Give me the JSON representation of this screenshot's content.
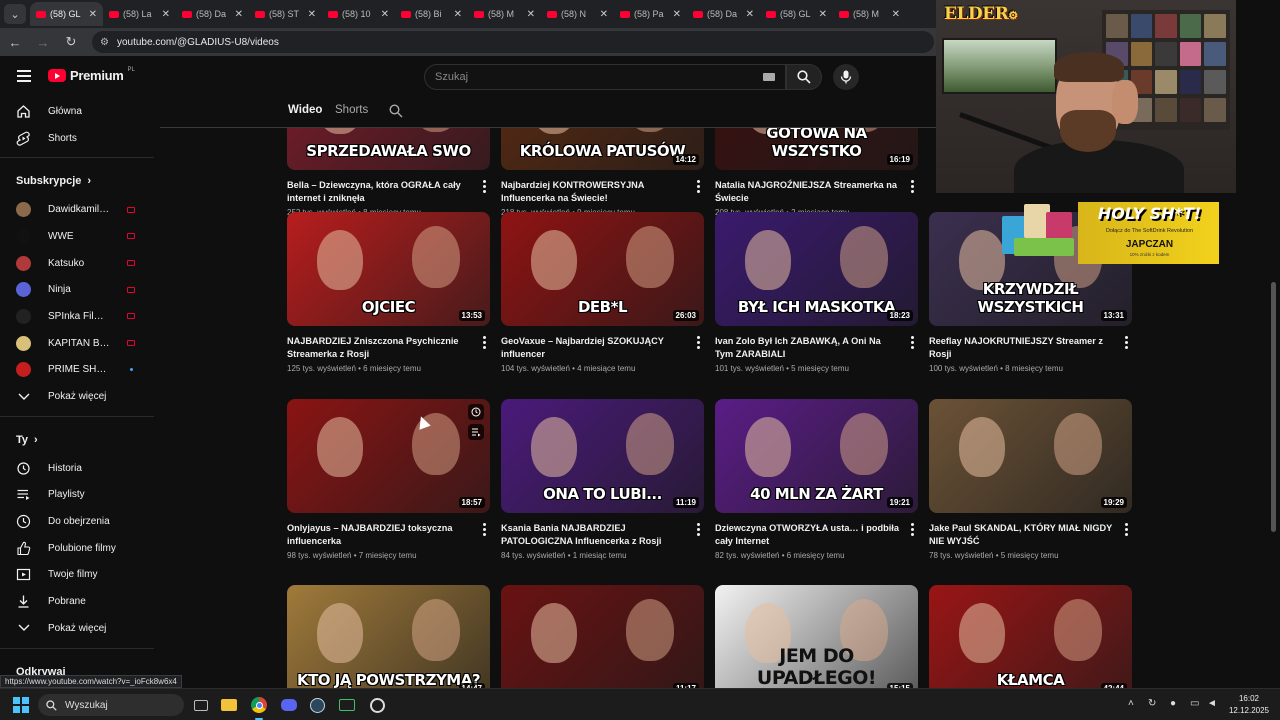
{
  "browser": {
    "tabs": [
      {
        "label": "(58) GL",
        "active": true
      },
      {
        "label": "(58) La",
        "active": false
      },
      {
        "label": "(58) Da",
        "active": false
      },
      {
        "label": "(58) ST",
        "active": false
      },
      {
        "label": "(58) 10",
        "active": false
      },
      {
        "label": "(58) Bi",
        "active": false
      },
      {
        "label": "(58) M",
        "active": false
      },
      {
        "label": "(58) N",
        "active": false
      },
      {
        "label": "(58) Pa",
        "active": false
      },
      {
        "label": "(58) Da",
        "active": false
      },
      {
        "label": "(58) GL",
        "active": false
      },
      {
        "label": "(58) M",
        "active": false
      }
    ],
    "url": "youtube.com/@GLADIUS-U8/videos",
    "status_url": "https://www.youtube.com/watch?v=_ioFck8w6x4"
  },
  "masthead": {
    "logo_text": "Premium",
    "logo_region": "PL",
    "search_placeholder": "Szukaj"
  },
  "channel_tabs": [
    {
      "label": "Wideo",
      "active": true
    },
    {
      "label": "Shorts",
      "active": false
    }
  ],
  "sidebar": {
    "main": [
      {
        "label": "Główna",
        "icon": "home-icon"
      },
      {
        "label": "Shorts",
        "icon": "shorts-icon"
      }
    ],
    "subs_header": "Subskrypcje",
    "subs": [
      {
        "label": "Dawidkamillive",
        "color": "#8a6a4a",
        "status": "live"
      },
      {
        "label": "WWE",
        "color": "#111111",
        "status": "live"
      },
      {
        "label": "Katsuko",
        "color": "#b03a3a",
        "status": "live"
      },
      {
        "label": "Ninja",
        "color": "#5a63d8",
        "status": "live"
      },
      {
        "label": "SPInka Film Stud...",
        "color": "#222222",
        "status": "live"
      },
      {
        "label": "KAPITAN BOMB...",
        "color": "#d9c07a",
        "status": "live"
      },
      {
        "label": "PRIME SHOW M...",
        "color": "#c41e1e",
        "status": "new"
      }
    ],
    "subs_more": "Pokaż więcej",
    "you_header": "Ty",
    "you": [
      {
        "label": "Historia",
        "icon": "history-icon"
      },
      {
        "label": "Playlisty",
        "icon": "playlist-icon"
      },
      {
        "label": "Do obejrzenia",
        "icon": "watch-later-icon"
      },
      {
        "label": "Polubione filmy",
        "icon": "thumb-up-icon"
      },
      {
        "label": "Twoje filmy",
        "icon": "your-videos-icon"
      },
      {
        "label": "Pobrane",
        "icon": "download-icon"
      }
    ],
    "you_more": "Pokaż więcej",
    "explore_header": "Odkrywaj"
  },
  "videos": [
    {
      "title": "Bella – Dziewczyna, która OGRAŁA cały internet i zniknęła",
      "views": "252 tys. wyświetleń",
      "age": "8 miesięcy temu",
      "duration": "",
      "caption": "SPRZEDAWAŁA SWO",
      "bg": "#7a1c2a"
    },
    {
      "title": "Najbardziej KONTROWERSYJNA Influencerka na Świecie!",
      "views": "218 tys. wyświetleń",
      "age": "9 miesięcy temu",
      "duration": "14:12",
      "caption": "KRÓLOWA PATUSÓW",
      "bg": "#5a2a12"
    },
    {
      "title": "Natalia NAJGROŹNIEJSZA Streamerka na Świecie",
      "views": "208 tys. wyświetleń",
      "age": "2 miesiące temu",
      "duration": "16:19",
      "caption": "GOTOWA NA WSZYSTKO",
      "bg": "#3a1010"
    },
    {
      "title": "NAJBARDZIEJ Zniszczona Psychicznie Streamerka z Rosji",
      "views": "125 tys. wyświetleń",
      "age": "6 miesięcy temu",
      "duration": "13:53",
      "caption": "OJCIEC",
      "bg": "#b81d1d"
    },
    {
      "title": "GeoVaxue – Najbardziej SZOKUJĄCY influencer",
      "views": "104 tys. wyświetleń",
      "age": "4 miesiące temu",
      "duration": "26:03",
      "caption": "DEB*L",
      "bg": "#8f1313"
    },
    {
      "title": "Ivan Zolo Był Ich ZABAWKĄ, A Oni Na Tym ZARABIALI",
      "views": "101 tys. wyświetleń",
      "age": "5 miesięcy temu",
      "duration": "18:23",
      "caption": "BYŁ ICH MASKOTKĄ",
      "bg": "#3a1a6e"
    },
    {
      "title": "Reeflay NAJOKRUTNIEJSZY Streamer z Rosji",
      "views": "100 tys. wyświetleń",
      "age": "8 miesięcy temu",
      "duration": "13:31",
      "caption": "KRZYWDZIŁ WSZYSTKICH",
      "bg": "#3b2f4f"
    },
    {
      "title": "Onlyjayus – NAJBARDZIEJ toksyczna influencerka",
      "views": "98 tys. wyświetleń",
      "age": "7 miesięcy temu",
      "duration": "18:57",
      "caption": "",
      "bg": "#8a1414"
    },
    {
      "title": "Ksania Bania NAJBARDZIEJ PATOLOGICZNA Influencerka z Rosji",
      "views": "84 tys. wyświetleń",
      "age": "1 miesiąc temu",
      "duration": "11:19",
      "caption": "ONA TO LUBI...",
      "bg": "#4a1a7a"
    },
    {
      "title": "Dziewczyna OTWORZYŁA usta… i podbiła cały Internet",
      "views": "82 tys. wyświetleń",
      "age": "6 miesięcy temu",
      "duration": "19:21",
      "caption": "40 MLN ZA ŻART",
      "bg": "#5a1d86"
    },
    {
      "title": "Jake Paul SKANDAL, KTÓRY MIAŁ NIGDY NIE WYJŚĆ",
      "views": "78 tys. wyświetleń",
      "age": "5 miesięcy temu",
      "duration": "19:29",
      "caption": "",
      "bg": "#6b5236"
    },
    {
      "title": "",
      "views": "",
      "age": "",
      "duration": "14:47",
      "caption": "KTO JĄ POWSTRZYMA?",
      "bg": "#a07a3a"
    },
    {
      "title": "",
      "views": "",
      "age": "",
      "duration": "11:17",
      "caption": "",
      "bg": "#6a1212"
    },
    {
      "title": "",
      "views": "",
      "age": "",
      "duration": "15:15",
      "caption": "JEM DO UPADŁEGO!",
      "bg": "#f2f2f2"
    },
    {
      "title": "",
      "views": "",
      "age": "",
      "duration": "42:44",
      "caption": "KŁAMCA",
      "bg": "#9a1515"
    }
  ],
  "overlay": {
    "cam_logo": "ELDER",
    "ad_title": "HOLY SH*T!",
    "ad_sub": "Dołącz do The SoftDrink Revolution",
    "ad_brand": "JAPCZAN",
    "ad_small": "10% zniżki z kodem"
  },
  "taskbar": {
    "search_label": "Wyszukaj",
    "time": "16:02",
    "date": "12.12.2025"
  }
}
